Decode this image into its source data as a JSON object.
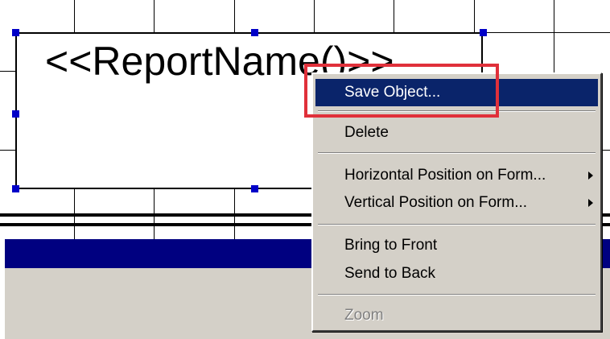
{
  "canvas": {
    "report_object": {
      "text": "<<ReportName()>>"
    }
  },
  "context_menu": {
    "items": [
      {
        "label": "Save Object...",
        "state": "highlighted"
      },
      {
        "label": "Delete"
      },
      {
        "label": "Horizontal Position on Form...",
        "submenu": true
      },
      {
        "label": "Vertical Position on Form...",
        "submenu": true
      },
      {
        "label": "Bring to Front"
      },
      {
        "label": "Send to Back"
      },
      {
        "label": "Zoom",
        "state": "disabled"
      }
    ]
  },
  "colors": {
    "menu_highlight": "#0a246a",
    "band_bar": "#000080",
    "selection_handle": "#0000c8",
    "callout_outline": "#e0303a",
    "menu_background": "#d4d0c8"
  },
  "icons": {
    "submenu_arrow": "triangle-right"
  }
}
